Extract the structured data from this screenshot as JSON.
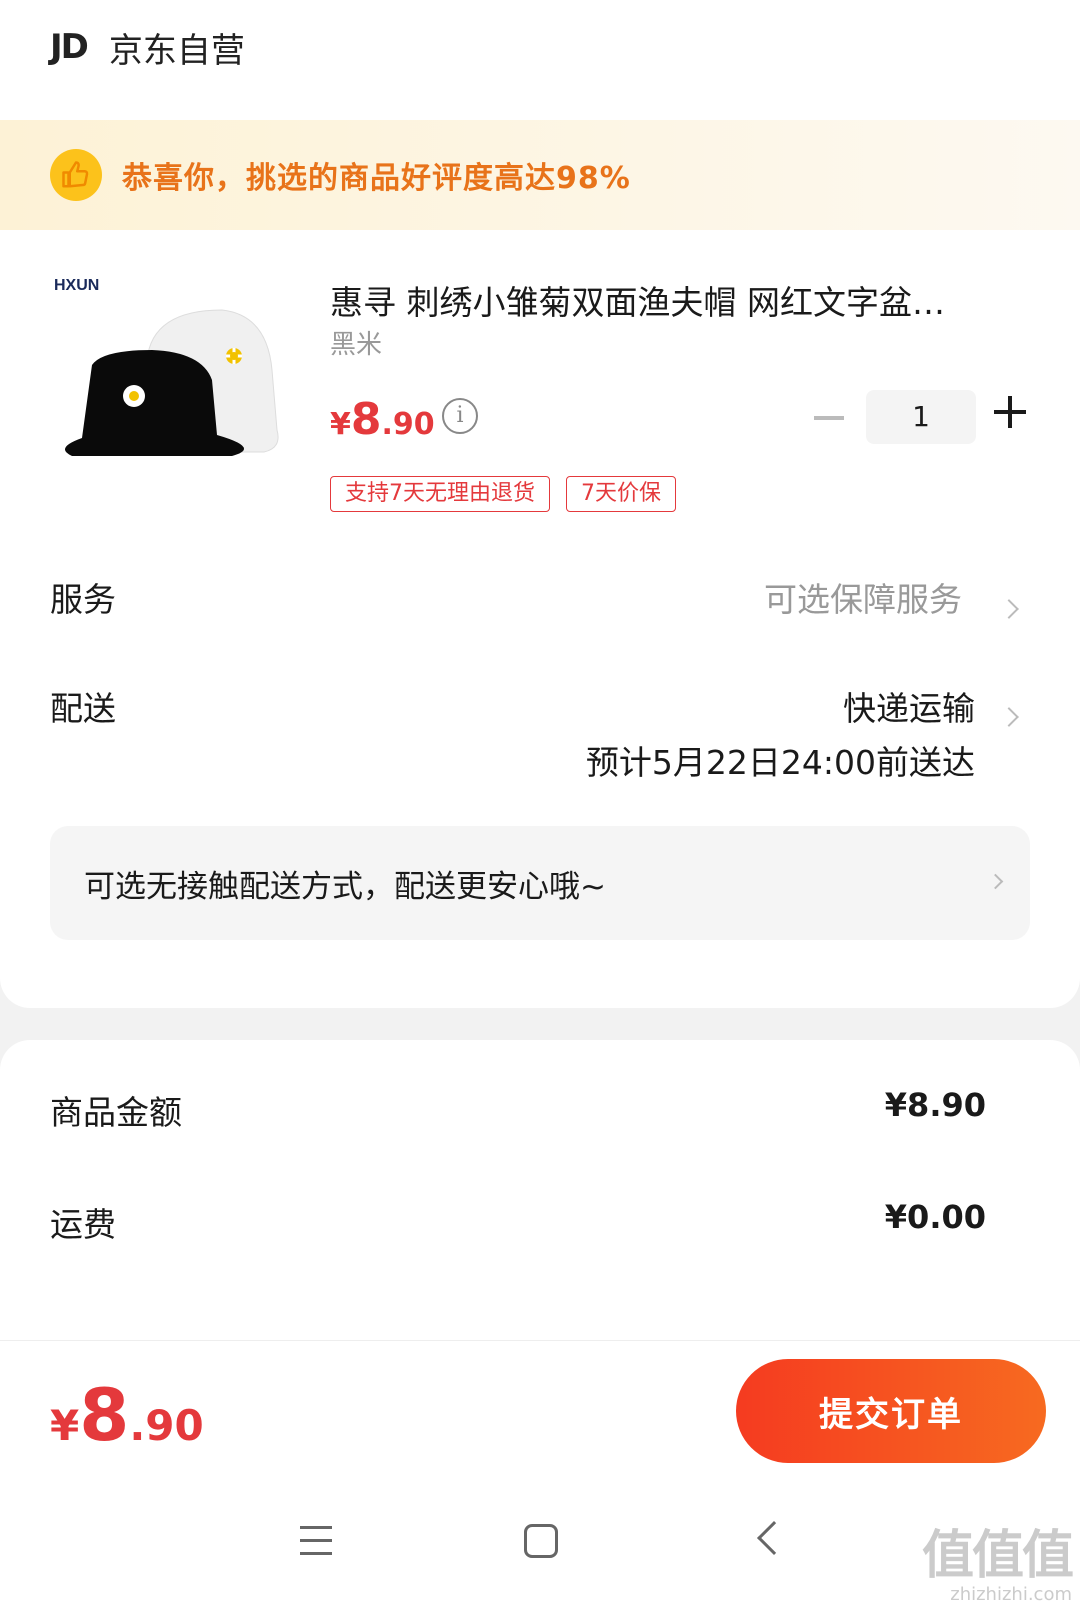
{
  "shop": {
    "logo_text": "JD",
    "name": "京东自营"
  },
  "banner": {
    "text": "恭喜你，挑选的商品好评度高达98%"
  },
  "product": {
    "brand_logo_text": "HXUN",
    "title": "惠寻 刺绣小雏菊双面渔夫帽 网红文字盆…",
    "variant": "黑米",
    "price": {
      "currency": "¥",
      "integer": "8",
      "decimal": ".90"
    },
    "quantity": "1",
    "tags": [
      "支持7天无理由退货",
      "7天价保"
    ]
  },
  "service": {
    "label": "服务",
    "value": "可选保障服务"
  },
  "delivery": {
    "label": "配送",
    "method": "快递运输",
    "eta": "预计5月22日24:00前送达"
  },
  "contactless": {
    "text": "可选无接触配送方式，配送更安心哦~"
  },
  "summary": {
    "goods_amount_label": "商品金额",
    "goods_amount_value": "¥8.90",
    "shipping_label": "运费",
    "shipping_value": "¥0.00"
  },
  "footer": {
    "total": {
      "currency": "¥",
      "integer": "8",
      "decimal": ".90"
    },
    "submit_label": "提交订单"
  },
  "watermark": {
    "text": "值值值",
    "sub": "zhizhizhi.com"
  },
  "colors": {
    "accent": "#e4393c",
    "banner_text": "#e8731a",
    "button": "#f53b20"
  }
}
